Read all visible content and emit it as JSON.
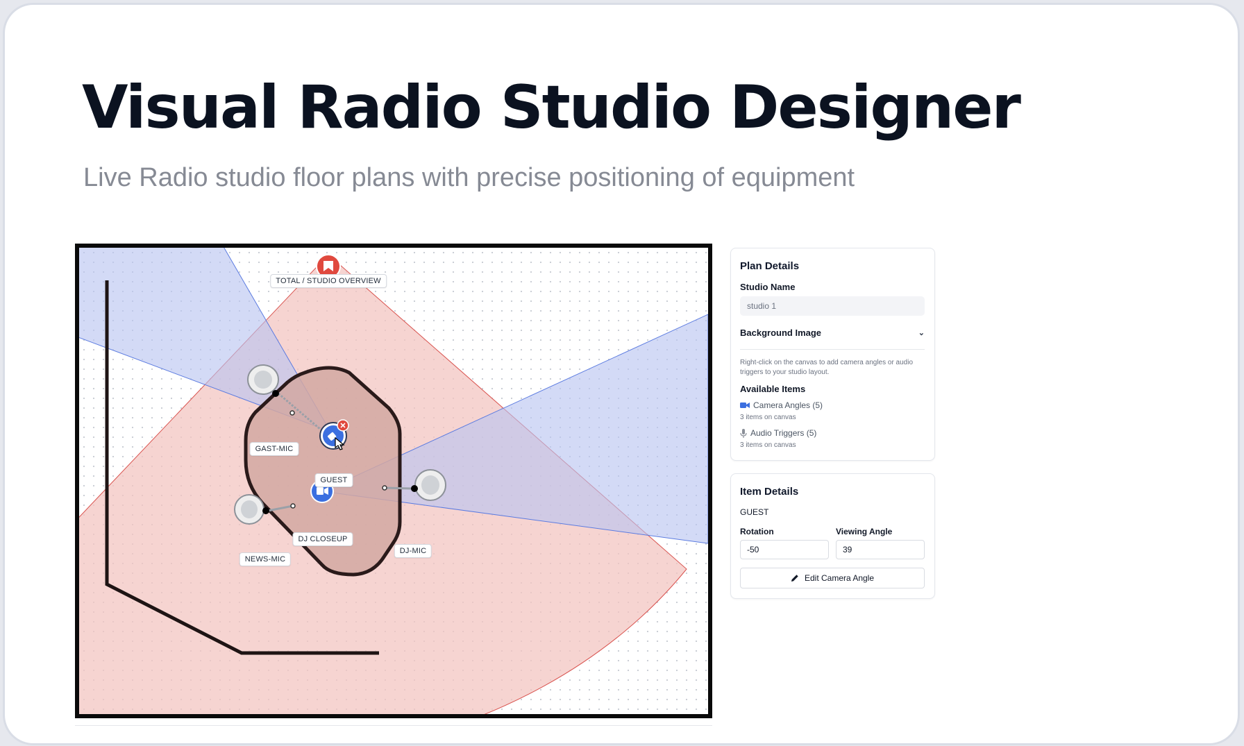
{
  "header": {
    "title": "Visual Radio Studio Designer",
    "subtitle": "Live Radio studio floor plans with precise positioning of equipment"
  },
  "canvas": {
    "labels": {
      "overview": "TOTAL / STUDIO OVERVIEW",
      "gast_mic": "GAST-MIC",
      "guest": "GUEST",
      "dj_closeup": "DJ CLOSEUP",
      "news_mic": "NEWS-MIC",
      "dj_mic": "DJ-MIC"
    },
    "colors": {
      "camera_red": "#e0493e",
      "camera_blue": "#3b6fe0",
      "fov_red_fill": "#f3c3bf",
      "fov_blue_fill": "#c4cdf3"
    }
  },
  "plan_details": {
    "heading": "Plan Details",
    "studio_name_label": "Studio Name",
    "studio_name_value": "studio 1",
    "background_image_label": "Background Image",
    "hint": "Right-click on the canvas to add camera angles or audio triggers to your studio layout.",
    "available_items_label": "Available Items",
    "camera_angles": {
      "label": "Camera Angles (5)",
      "sub": "3 items on canvas",
      "icon": "video-camera-icon"
    },
    "audio_triggers": {
      "label": "Audio Triggers (5)",
      "sub": "3 items on canvas",
      "icon": "microphone-icon"
    }
  },
  "item_details": {
    "heading": "Item Details",
    "item_name": "GUEST",
    "rotation_label": "Rotation",
    "rotation_value": "-50",
    "viewing_angle_label": "Viewing Angle",
    "viewing_angle_value": "39",
    "edit_button": "Edit Camera Angle"
  }
}
